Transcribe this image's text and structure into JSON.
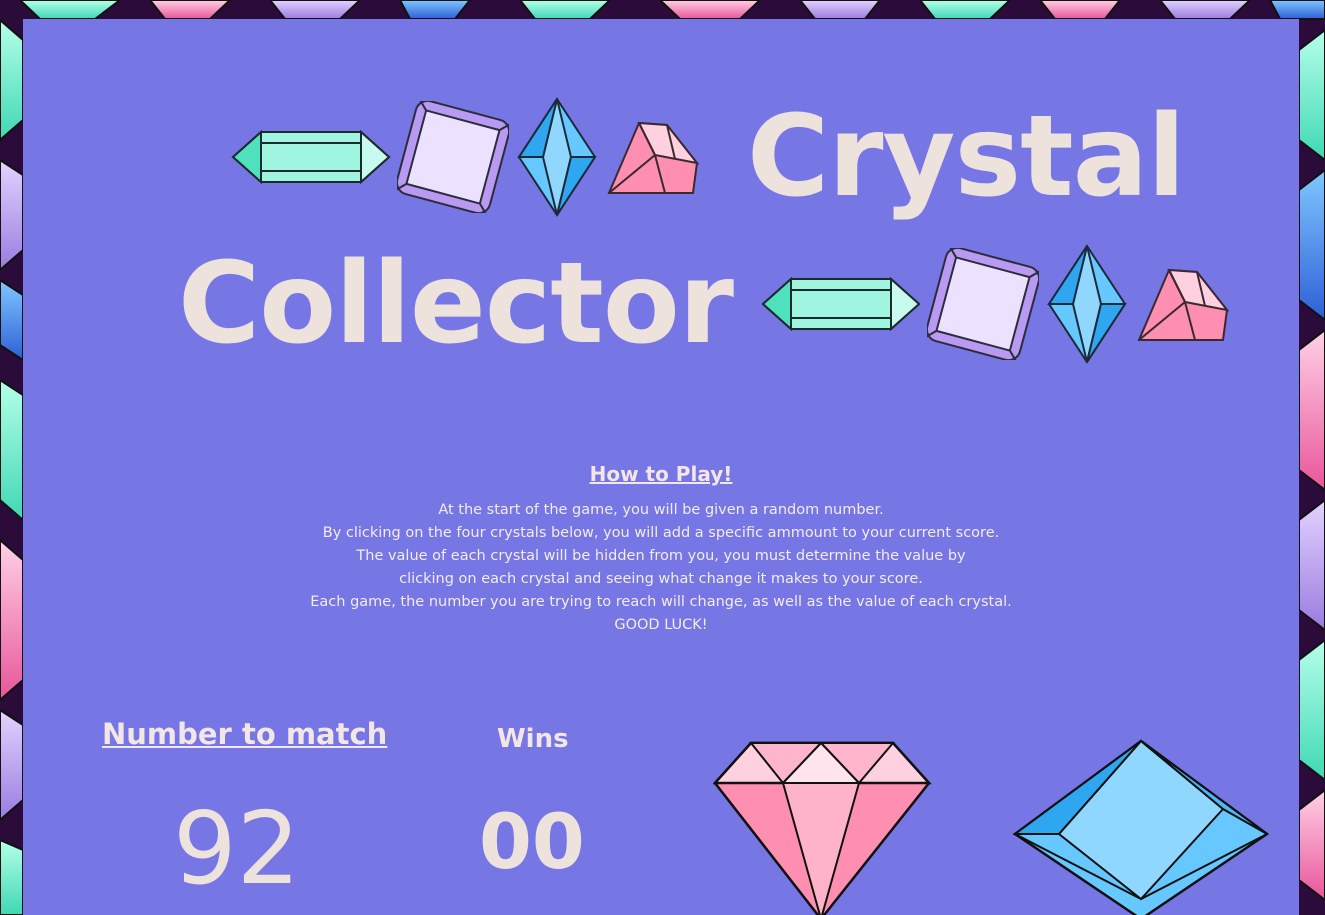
{
  "game": {
    "title_part_1": "Crystal",
    "title_part_2": "Collector"
  },
  "instructions": {
    "heading": "How to Play!",
    "lines": [
      "At the start of the game, you will be given a random number.",
      "By clicking on the four crystals below, you will add a specific ammount to your current score.",
      "The value of each crystal will be hidden from you, you must determine the value by",
      "clicking on each crystal and seeing what change it makes to your score.",
      "Each game, the number you are trying to reach will change, as well as the value of each crystal.",
      "GOOD LUCK!"
    ]
  },
  "scoreboard": {
    "number_label": "Number to match",
    "number_value": "92",
    "wins_label": "Wins",
    "wins_value": "00"
  },
  "crystals": [
    {
      "icon": "pink-diamond-crystal-icon",
      "color": "#ff8fb0"
    },
    {
      "icon": "blue-diamond-crystal-icon",
      "color": "#66ccff"
    }
  ],
  "colors": {
    "panel": "#7676e4",
    "title": "#eee2dc",
    "text": "#f3ecf0"
  }
}
